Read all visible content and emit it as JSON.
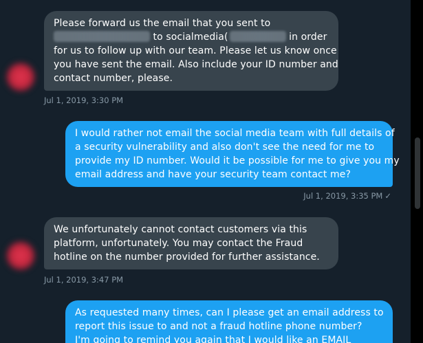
{
  "messages": [
    {
      "direction": "incoming",
      "lines": [
        {
          "before": "Please forward us the email that you sent to",
          "redacted": false
        },
        {
          "after": " to socialmedia(",
          "redacted": true,
          "tail": "in order"
        },
        {
          "text": "for us to follow up with our team. Please let us know once"
        },
        {
          "text": "you have sent the email. Also include your ID number and"
        },
        {
          "text": "contact number, please."
        }
      ],
      "timestamp": "Jul 1, 2019, 3:30 PM"
    },
    {
      "direction": "outgoing",
      "lines": [
        "I would rather not email the social media team with full details of",
        "a security vulnerability and also don't see the need for me to",
        "provide my ID number. Would it be possible for me to give you my",
        "email address and have your security team contact me?"
      ],
      "timestamp": "Jul 1, 2019, 3:35 PM",
      "read_mark": "✓"
    },
    {
      "direction": "incoming",
      "lines": [
        "We unfortunately cannot contact customers via this",
        "platform, unfortunately. You may contact the Fraud",
        "hotline on the number provided for further assistance."
      ],
      "timestamp": "Jul 1, 2019, 3:47 PM"
    },
    {
      "direction": "outgoing",
      "lines": [
        "As requested many times, can I please get an email address to",
        "report this issue to and not a fraud hotline phone number?",
        "I'm going to remind you again that I would like an EMAIL"
      ]
    }
  ],
  "colors": {
    "background": "#15202b",
    "incoming_bubble": "#38444d",
    "outgoing_bubble": "#1da1f2",
    "timestamp": "#8899a6"
  }
}
